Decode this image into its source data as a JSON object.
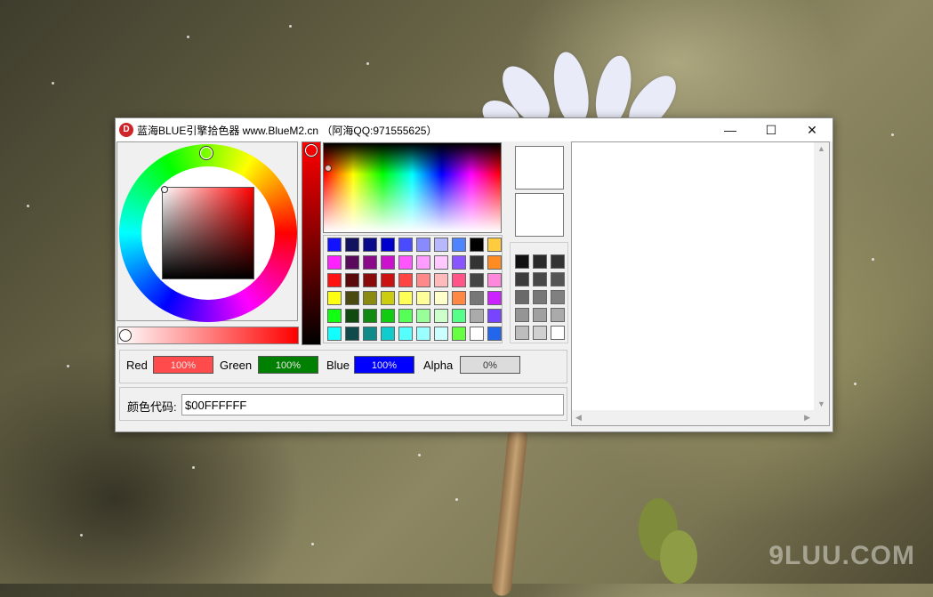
{
  "window": {
    "title": "蓝海BLUE引擎拾色器 www.BlueM2.cn （阿海QQ:971555625）",
    "icon_glyph": "D",
    "minimize_glyph": "—",
    "maximize_glyph": "☐",
    "close_glyph": "✕"
  },
  "channels": {
    "red": {
      "label": "Red",
      "value": "100%",
      "color": "#ff4b4b"
    },
    "green": {
      "label": "Green",
      "value": "100%",
      "color": "#008000"
    },
    "blue": {
      "label": "Blue",
      "value": "100%",
      "color": "#0000ff"
    },
    "alpha": {
      "label": "Alpha",
      "value": "0%",
      "color": "#dcdcdc"
    }
  },
  "color_code": {
    "label": "颜色代码:",
    "value": "$00FFFFFF"
  },
  "current_color": "#ff0000",
  "swatches": [
    [
      "#1212ff",
      "#12125f",
      "#0a0a8a",
      "#0000cc",
      "#4a4aff",
      "#8a8aff",
      "#b8b8ff",
      "#4f84ff",
      "#000000",
      "#ffcc40"
    ],
    [
      "#ff22ff",
      "#5a0a5a",
      "#8a0a8a",
      "#cc11cc",
      "#ff55ff",
      "#ff9cff",
      "#ffc8ff",
      "#8855ff",
      "#333333",
      "#ff8c22"
    ],
    [
      "#ff1111",
      "#5a0a0a",
      "#8a0a0a",
      "#cc1111",
      "#ff4444",
      "#ff8888",
      "#ffbbbb",
      "#ff5588",
      "#444444",
      "#ff88dd"
    ],
    [
      "#ffff11",
      "#4a4a11",
      "#8a8a11",
      "#cccc11",
      "#ffff55",
      "#ffff99",
      "#ffffcc",
      "#ff8844",
      "#777777",
      "#cc22ff"
    ],
    [
      "#11ff11",
      "#114a11",
      "#118a11",
      "#11cc11",
      "#55ff55",
      "#99ff99",
      "#ccffcc",
      "#55ff88",
      "#aaaaaa",
      "#7744ff"
    ],
    [
      "#11ffff",
      "#114a4a",
      "#118a8a",
      "#11cccc",
      "#55ffff",
      "#99ffff",
      "#ccffff",
      "#66ff44",
      "#ffffff",
      "#2266ee"
    ]
  ],
  "grays": [
    [
      "#111111",
      "#2a2a2a",
      "#333333"
    ],
    [
      "#3c3c3c",
      "#474747",
      "#555555"
    ],
    [
      "#6a6a6a",
      "#777777",
      "#808080"
    ],
    [
      "#959595",
      "#a0a0a0",
      "#aaaaaa"
    ],
    [
      "#bdbdbd",
      "#d0d0d0",
      "#ffffff"
    ]
  ],
  "watermark": "9LUU.COM"
}
